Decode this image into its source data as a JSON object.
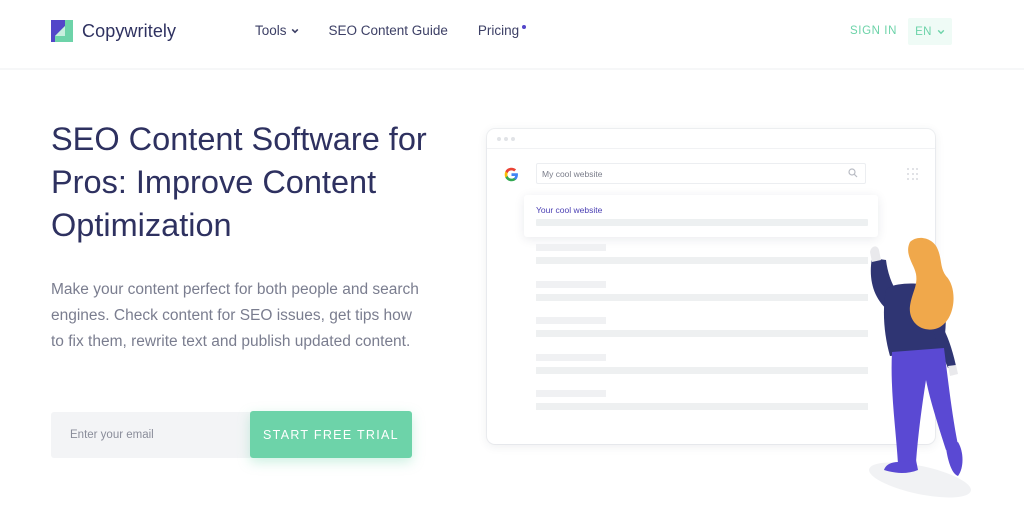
{
  "header": {
    "brand": "Copywritely",
    "nav": [
      {
        "label": "Tools",
        "has_dropdown": true
      },
      {
        "label": "SEO Content Guide",
        "has_dropdown": false
      },
      {
        "label": "Pricing",
        "has_badge_dot": true
      }
    ],
    "sign_in_label": "SIGN IN",
    "language": "EN"
  },
  "hero": {
    "headline": "SEO Content Software for Pros: Improve Content Optimization",
    "description": "Make your content perfect for both people and search engines. Check content for SEO issues, get tips how to fix them, rewrite text and publish updated content.",
    "email_placeholder": "Enter your email",
    "cta_label": "START FREE TRIAL"
  },
  "mockup": {
    "search_query": "My cool website",
    "result_title": "Your cool website",
    "skeleton_result_count": 5
  },
  "colors": {
    "primary_text": "#2e3160",
    "accent_green": "#6dd3a9",
    "accent_purple": "#5346c9",
    "hair_orange": "#f0a84b",
    "shirt_navy": "#2f3573",
    "pants_purple": "#5a49d3"
  },
  "icons": {
    "logo": "copywritely-logo-icon",
    "tools_chevron": "chevron-down-icon",
    "lang_chevron": "chevron-down-icon",
    "search": "search-icon",
    "google": "google-icon",
    "apps": "apps-grid-icon"
  }
}
